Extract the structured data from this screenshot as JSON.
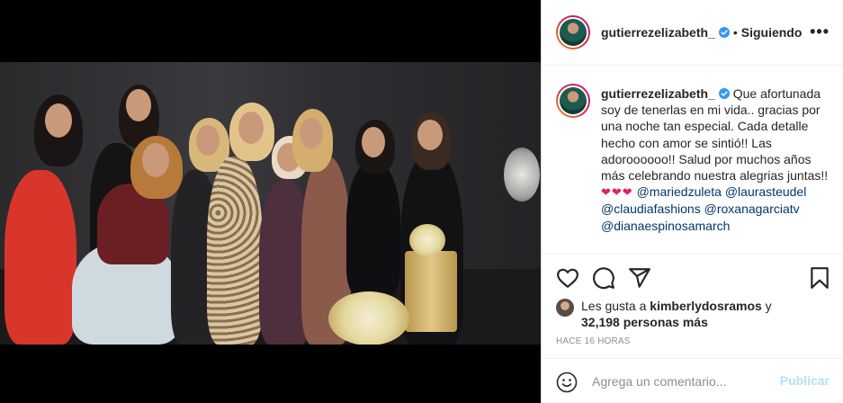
{
  "post": {
    "username": "gutierrezelizabeth_",
    "separator": "•",
    "follow_status": "Siguiendo",
    "more_label": "•••"
  },
  "caption": {
    "username": "gutierrezelizabeth_",
    "text": "Que afortunada soy de tenerlas en mi vida.. gracias por una noche tan especial. Cada detalle hecho con amor se sintió!! Las adoroooooo!! Salud por muchos años más celebrando nuestra alegrias juntas!!",
    "hearts": "❤❤❤",
    "mentions": [
      "@mariedzuleta",
      "@laurasteudel",
      "@claudiafashions",
      "@roxanagarciatv",
      "@dianaespinosamarch"
    ]
  },
  "likes": {
    "prefix": "Les gusta a",
    "user": "kimberlydosramos",
    "conj": "y",
    "count": "32,198 personas más"
  },
  "timestamp": "HACE 16 HORAS",
  "comment_box": {
    "placeholder": "Agrega un comentario...",
    "publish_label": "Publicar"
  },
  "icons": {
    "more": "more-icon",
    "verified": "verified-badge-icon",
    "like": "heart-icon",
    "comment": "comment-icon",
    "share": "share-icon",
    "save": "bookmark-icon",
    "emoji": "emoji-icon"
  },
  "colors": {
    "verified": "#3897f0",
    "mention": "#00376b",
    "publish_disabled": "#b2dffc",
    "muted": "#8e8e8e"
  }
}
